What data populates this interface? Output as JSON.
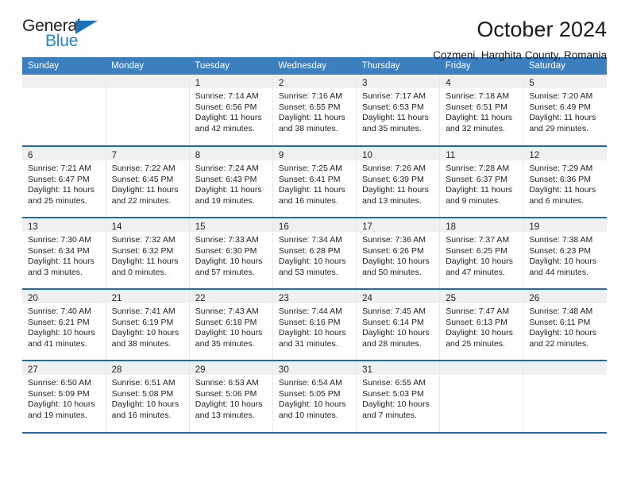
{
  "brand": {
    "name_top": "General",
    "name_bottom": "Blue",
    "accent_color": "#2084cd",
    "triangle_color": "#1b72b8"
  },
  "header": {
    "title": "October 2024",
    "location": "Cozmeni, Harghita County, Romania"
  },
  "calendar": {
    "header_bg": "#3b7fbf",
    "row_rule_color": "#1c6cb0",
    "daynum_band_bg": "#f0f0f0",
    "weekday_headers": [
      "Sunday",
      "Monday",
      "Tuesday",
      "Wednesday",
      "Thursday",
      "Friday",
      "Saturday"
    ],
    "weeks": [
      [
        {
          "day": "",
          "sunrise": "",
          "sunset": "",
          "daylight": ""
        },
        {
          "day": "",
          "sunrise": "",
          "sunset": "",
          "daylight": ""
        },
        {
          "day": "1",
          "sunrise": "Sunrise: 7:14 AM",
          "sunset": "Sunset: 6:56 PM",
          "daylight": "Daylight: 11 hours and 42 minutes."
        },
        {
          "day": "2",
          "sunrise": "Sunrise: 7:16 AM",
          "sunset": "Sunset: 6:55 PM",
          "daylight": "Daylight: 11 hours and 38 minutes."
        },
        {
          "day": "3",
          "sunrise": "Sunrise: 7:17 AM",
          "sunset": "Sunset: 6:53 PM",
          "daylight": "Daylight: 11 hours and 35 minutes."
        },
        {
          "day": "4",
          "sunrise": "Sunrise: 7:18 AM",
          "sunset": "Sunset: 6:51 PM",
          "daylight": "Daylight: 11 hours and 32 minutes."
        },
        {
          "day": "5",
          "sunrise": "Sunrise: 7:20 AM",
          "sunset": "Sunset: 6:49 PM",
          "daylight": "Daylight: 11 hours and 29 minutes."
        }
      ],
      [
        {
          "day": "6",
          "sunrise": "Sunrise: 7:21 AM",
          "sunset": "Sunset: 6:47 PM",
          "daylight": "Daylight: 11 hours and 25 minutes."
        },
        {
          "day": "7",
          "sunrise": "Sunrise: 7:22 AM",
          "sunset": "Sunset: 6:45 PM",
          "daylight": "Daylight: 11 hours and 22 minutes."
        },
        {
          "day": "8",
          "sunrise": "Sunrise: 7:24 AM",
          "sunset": "Sunset: 6:43 PM",
          "daylight": "Daylight: 11 hours and 19 minutes."
        },
        {
          "day": "9",
          "sunrise": "Sunrise: 7:25 AM",
          "sunset": "Sunset: 6:41 PM",
          "daylight": "Daylight: 11 hours and 16 minutes."
        },
        {
          "day": "10",
          "sunrise": "Sunrise: 7:26 AM",
          "sunset": "Sunset: 6:39 PM",
          "daylight": "Daylight: 11 hours and 13 minutes."
        },
        {
          "day": "11",
          "sunrise": "Sunrise: 7:28 AM",
          "sunset": "Sunset: 6:37 PM",
          "daylight": "Daylight: 11 hours and 9 minutes."
        },
        {
          "day": "12",
          "sunrise": "Sunrise: 7:29 AM",
          "sunset": "Sunset: 6:36 PM",
          "daylight": "Daylight: 11 hours and 6 minutes."
        }
      ],
      [
        {
          "day": "13",
          "sunrise": "Sunrise: 7:30 AM",
          "sunset": "Sunset: 6:34 PM",
          "daylight": "Daylight: 11 hours and 3 minutes."
        },
        {
          "day": "14",
          "sunrise": "Sunrise: 7:32 AM",
          "sunset": "Sunset: 6:32 PM",
          "daylight": "Daylight: 11 hours and 0 minutes."
        },
        {
          "day": "15",
          "sunrise": "Sunrise: 7:33 AM",
          "sunset": "Sunset: 6:30 PM",
          "daylight": "Daylight: 10 hours and 57 minutes."
        },
        {
          "day": "16",
          "sunrise": "Sunrise: 7:34 AM",
          "sunset": "Sunset: 6:28 PM",
          "daylight": "Daylight: 10 hours and 53 minutes."
        },
        {
          "day": "17",
          "sunrise": "Sunrise: 7:36 AM",
          "sunset": "Sunset: 6:26 PM",
          "daylight": "Daylight: 10 hours and 50 minutes."
        },
        {
          "day": "18",
          "sunrise": "Sunrise: 7:37 AM",
          "sunset": "Sunset: 6:25 PM",
          "daylight": "Daylight: 10 hours and 47 minutes."
        },
        {
          "day": "19",
          "sunrise": "Sunrise: 7:38 AM",
          "sunset": "Sunset: 6:23 PM",
          "daylight": "Daylight: 10 hours and 44 minutes."
        }
      ],
      [
        {
          "day": "20",
          "sunrise": "Sunrise: 7:40 AM",
          "sunset": "Sunset: 6:21 PM",
          "daylight": "Daylight: 10 hours and 41 minutes."
        },
        {
          "day": "21",
          "sunrise": "Sunrise: 7:41 AM",
          "sunset": "Sunset: 6:19 PM",
          "daylight": "Daylight: 10 hours and 38 minutes."
        },
        {
          "day": "22",
          "sunrise": "Sunrise: 7:43 AM",
          "sunset": "Sunset: 6:18 PM",
          "daylight": "Daylight: 10 hours and 35 minutes."
        },
        {
          "day": "23",
          "sunrise": "Sunrise: 7:44 AM",
          "sunset": "Sunset: 6:16 PM",
          "daylight": "Daylight: 10 hours and 31 minutes."
        },
        {
          "day": "24",
          "sunrise": "Sunrise: 7:45 AM",
          "sunset": "Sunset: 6:14 PM",
          "daylight": "Daylight: 10 hours and 28 minutes."
        },
        {
          "day": "25",
          "sunrise": "Sunrise: 7:47 AM",
          "sunset": "Sunset: 6:13 PM",
          "daylight": "Daylight: 10 hours and 25 minutes."
        },
        {
          "day": "26",
          "sunrise": "Sunrise: 7:48 AM",
          "sunset": "Sunset: 6:11 PM",
          "daylight": "Daylight: 10 hours and 22 minutes."
        }
      ],
      [
        {
          "day": "27",
          "sunrise": "Sunrise: 6:50 AM",
          "sunset": "Sunset: 5:09 PM",
          "daylight": "Daylight: 10 hours and 19 minutes."
        },
        {
          "day": "28",
          "sunrise": "Sunrise: 6:51 AM",
          "sunset": "Sunset: 5:08 PM",
          "daylight": "Daylight: 10 hours and 16 minutes."
        },
        {
          "day": "29",
          "sunrise": "Sunrise: 6:53 AM",
          "sunset": "Sunset: 5:06 PM",
          "daylight": "Daylight: 10 hours and 13 minutes."
        },
        {
          "day": "30",
          "sunrise": "Sunrise: 6:54 AM",
          "sunset": "Sunset: 5:05 PM",
          "daylight": "Daylight: 10 hours and 10 minutes."
        },
        {
          "day": "31",
          "sunrise": "Sunrise: 6:55 AM",
          "sunset": "Sunset: 5:03 PM",
          "daylight": "Daylight: 10 hours and 7 minutes."
        },
        {
          "day": "",
          "sunrise": "",
          "sunset": "",
          "daylight": ""
        },
        {
          "day": "",
          "sunrise": "",
          "sunset": "",
          "daylight": ""
        }
      ]
    ]
  }
}
